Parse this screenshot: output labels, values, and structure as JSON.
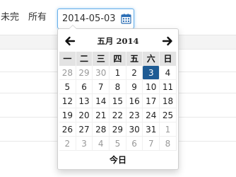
{
  "filters": {
    "incomplete_label": "未完",
    "all_label": "所有",
    "date_value": "2014-05-03"
  },
  "datepicker": {
    "month_title": "五月 2014",
    "prev_symbol": "prev",
    "next_symbol": "next",
    "weekdays": [
      "一",
      "二",
      "三",
      "四",
      "五",
      "六",
      "日"
    ],
    "days": [
      {
        "d": "28",
        "muted": true
      },
      {
        "d": "29",
        "muted": true
      },
      {
        "d": "30",
        "muted": true
      },
      {
        "d": "1"
      },
      {
        "d": "2"
      },
      {
        "d": "3",
        "active": true
      },
      {
        "d": "4"
      },
      {
        "d": "5"
      },
      {
        "d": "6"
      },
      {
        "d": "7"
      },
      {
        "d": "8"
      },
      {
        "d": "9"
      },
      {
        "d": "10"
      },
      {
        "d": "11"
      },
      {
        "d": "12"
      },
      {
        "d": "13"
      },
      {
        "d": "14"
      },
      {
        "d": "15"
      },
      {
        "d": "16"
      },
      {
        "d": "17"
      },
      {
        "d": "18"
      },
      {
        "d": "19"
      },
      {
        "d": "20"
      },
      {
        "d": "21"
      },
      {
        "d": "22"
      },
      {
        "d": "23"
      },
      {
        "d": "24"
      },
      {
        "d": "25"
      },
      {
        "d": "26"
      },
      {
        "d": "27"
      },
      {
        "d": "28"
      },
      {
        "d": "29"
      },
      {
        "d": "30"
      },
      {
        "d": "31"
      },
      {
        "d": "1",
        "muted": true
      },
      {
        "d": "2",
        "muted": true
      },
      {
        "d": "3",
        "muted": true
      },
      {
        "d": "4",
        "muted": true
      },
      {
        "d": "5",
        "muted": true
      },
      {
        "d": "6",
        "muted": true
      },
      {
        "d": "7",
        "muted": true
      },
      {
        "d": "8",
        "muted": true
      }
    ],
    "today_label": "今日",
    "active_color": "#1e5b94"
  }
}
